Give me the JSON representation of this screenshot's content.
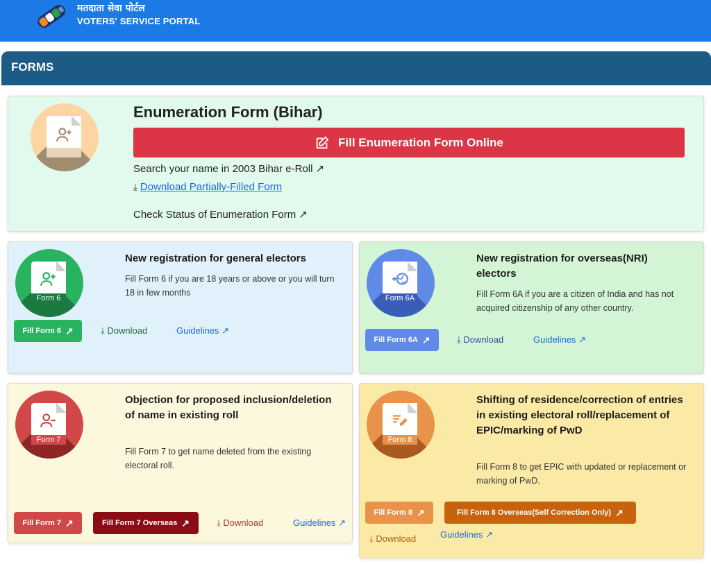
{
  "header": {
    "title_hi": "मतदाता सेवा पोर्टल",
    "title_en": "VOTERS' SERVICE PORTAL"
  },
  "section": {
    "title": "FORMS"
  },
  "enumeration": {
    "title": "Enumeration Form (Bihar)",
    "fill_online_label": "Fill Enumeration Form Online",
    "search_label": "Search your name in 2003 Bihar e-Roll",
    "download_partial_label": "Download Partially-Filled Form",
    "check_status_label": "Check Status of Enumeration Form"
  },
  "form6": {
    "badge": "Form 6",
    "title": "New registration for general electors",
    "desc": "Fill Form 6 if you are 18 years or above or you will turn 18 in few months",
    "fill_label": "Fill Form 6",
    "download_label": "Download",
    "guidelines_label": "Guidelines"
  },
  "form6a": {
    "badge": "Form 6A",
    "title": "New registration for overseas(NRI) electors",
    "desc": "Fill Form 6A if you are a citizen of India and has not acquired citizenship of any other country.",
    "fill_label": "Fill Form 6A",
    "download_label": "Download",
    "guidelines_label": "Guidelines"
  },
  "form7": {
    "badge": "Form 7",
    "title": "Objection for proposed inclusion/deletion of name in existing roll",
    "desc": "Fill Form 7 to get name deleted from the existing electoral roll.",
    "fill_label": "Fill Form 7",
    "fill_overseas_label": "Fill Form 7 Overseas",
    "download_label": "Download",
    "guidelines_label": "Guidelines"
  },
  "form8": {
    "badge": "Form 8",
    "title": "Shifting of residence/correction of entries in existing electoral roll/replacement of EPIC/marking of PwD",
    "desc": "Fill Form 8 to get EPIC with updated or replacement or marking of PwD.",
    "fill_label": "Fill Form 8",
    "fill_overseas_label": "Fill Form 8 Overseas(Self Correction Only)",
    "download_label": "Download",
    "guidelines_label": "Guidelines"
  },
  "colors": {
    "header_blue": "#1b7ae6",
    "forms_bar": "#1b5b86",
    "danger_red": "#dc3545",
    "form6_green": "#28b35f",
    "form6a_blue": "#5f8ae8",
    "form7_red": "#d24848",
    "form7_overseas": "#8b0c14",
    "form8_orange": "#e8924a",
    "form8_overseas": "#c9620c"
  },
  "icons": [
    "ballot-logo-icon",
    "edit-icon",
    "arrow-up-right-icon",
    "download-icon",
    "add-user-icon",
    "globe-icon",
    "remove-user-icon",
    "edit-lines-icon"
  ]
}
